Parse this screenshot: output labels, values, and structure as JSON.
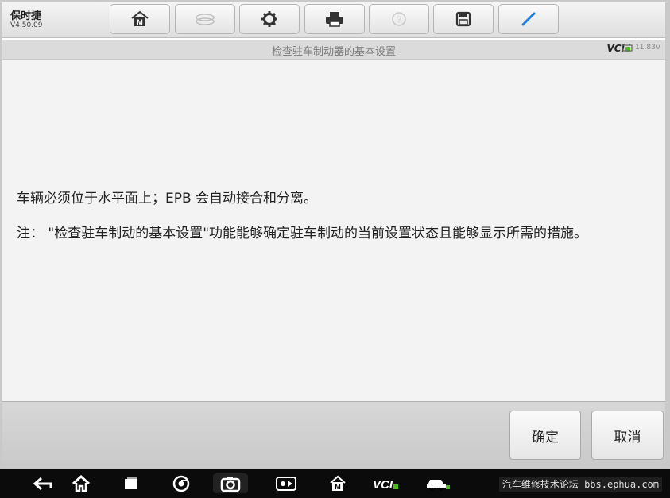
{
  "app": {
    "title": "保时捷",
    "version": "V4.50.09"
  },
  "toolbar": {
    "buttons": [
      {
        "icon": "home-icon",
        "enabled": true
      },
      {
        "icon": "vehicle-swap-icon",
        "enabled": false
      },
      {
        "icon": "settings-gear-icon",
        "enabled": true
      },
      {
        "icon": "printer-icon",
        "enabled": true
      },
      {
        "icon": "help-icon",
        "enabled": false
      },
      {
        "icon": "save-icon",
        "enabled": true
      },
      {
        "icon": "pen-icon",
        "enabled": true
      }
    ]
  },
  "titlebar": {
    "title": "检查驻车制动器的基本设置",
    "vci_label": "VCI",
    "battery_voltage": "11.83V"
  },
  "content": {
    "line1": "车辆必须位于水平面上；EPB 会自动接合和分离。",
    "line2": "注： \"检查驻车制动的基本设置\"功能能够确定驻车制动的当前设置状态且能够显示所需的措施。"
  },
  "footer": {
    "confirm_label": "确定",
    "cancel_label": "取消"
  },
  "navbar": {
    "items": [
      "back-icon",
      "home-icon",
      "recent-apps-icon",
      "chrome-icon",
      "camera-icon",
      "brightness-icon",
      "maxi-home-icon",
      "vci-icon",
      "car-icon"
    ],
    "watermark": "汽车维修技术论坛 bbs.ephua.com"
  },
  "colors": {
    "vci_dot": "#4cbb17",
    "pen_blue": "#1e7fe6"
  }
}
